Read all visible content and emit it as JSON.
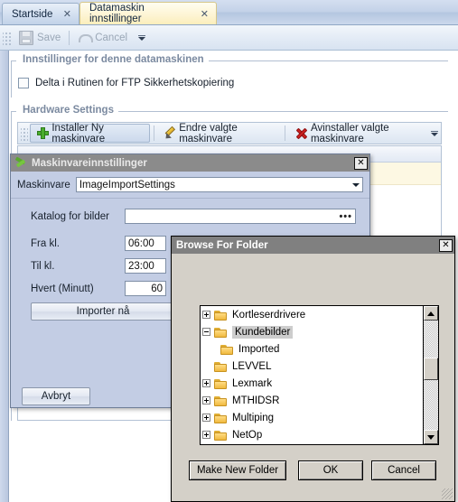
{
  "tabs": [
    {
      "label": "Startside",
      "close": "✕",
      "active": false
    },
    {
      "label": "Datamaskin innstillinger",
      "close": "✕",
      "active": true
    }
  ],
  "toolbar": {
    "save_label": "Save",
    "cancel_label": "Cancel",
    "save_icon": "floppy-disk-icon",
    "cancel_icon": "undo-arrow-icon",
    "overflow_icon": "toolbar-overflow-icon"
  },
  "computer_settings_group": {
    "title": "Innstillinger for denne datamaskinen",
    "checkbox_label": "Delta i Rutinen for FTP Sikkerhetskopiering",
    "checkbox_checked": false
  },
  "hardware_group": {
    "title": "Hardware Settings",
    "buttons": [
      {
        "label": "Installer Ny maskinvare",
        "icon": "green-plus-icon"
      },
      {
        "label": "Endre valgte maskinvare",
        "icon": "pencil-icon"
      },
      {
        "label": "Avinstaller valgte maskinvare",
        "icon": "red-x-icon"
      }
    ],
    "overflow_icon": "toolbar-overflow-icon"
  },
  "hardware_dialog": {
    "title": "Maskinvareinnstillinger",
    "title_icon": "green-hardware-icon",
    "close_label": "✕",
    "device_label": "Maskinvare",
    "device_value": "ImageImportSettings",
    "folder_label": "Katalog for bilder",
    "folder_value": "",
    "folder_browse_label": "•••",
    "from_label": "Fra kl.",
    "from_value": "06:00",
    "to_label": "Til kl.",
    "to_value": "23:00",
    "every_label": "Hvert (Minutt)",
    "every_value": "60",
    "import_now_label": "Importer nå",
    "cancel_label": "Avbryt"
  },
  "browse_dialog": {
    "title": "Browse For Folder",
    "close_label": "✕",
    "tree": [
      {
        "label": "Kortleserdrivere",
        "expander": "plus",
        "indent": 0,
        "selected": false
      },
      {
        "label": "Kundebilder",
        "expander": "minus",
        "indent": 0,
        "selected": true
      },
      {
        "label": "Imported",
        "expander": "none",
        "indent": 1,
        "selected": false
      },
      {
        "label": "LEVVEL",
        "expander": "none",
        "indent": 0,
        "selected": false
      },
      {
        "label": "Lexmark",
        "expander": "plus",
        "indent": 0,
        "selected": false
      },
      {
        "label": "MTHIDSR",
        "expander": "plus",
        "indent": 0,
        "selected": false
      },
      {
        "label": "Multiping",
        "expander": "plus",
        "indent": 0,
        "selected": false
      },
      {
        "label": "NetOp",
        "expander": "plus",
        "indent": 0,
        "selected": false
      }
    ],
    "make_new_folder_label": "Make New Folder",
    "ok_label": "OK",
    "cancel_label": "Cancel",
    "scroll_up_icon": "scroll-up-arrow-icon",
    "scroll_down_icon": "scroll-down-arrow-icon"
  },
  "colors": {
    "active_tab": "#fdf4d2",
    "inactive_tab": "#d2dff0",
    "dialog_body": "#c3cde4",
    "dialog_titlebar": "#8b8b8b",
    "browse_titlebar": "#808080",
    "browse_body": "#d4d0c8",
    "accent_green": "#4aae2e",
    "accent_red": "#cc2222",
    "folder_yellow": "#f0b93f",
    "grid_row": "#fdf8e3"
  }
}
